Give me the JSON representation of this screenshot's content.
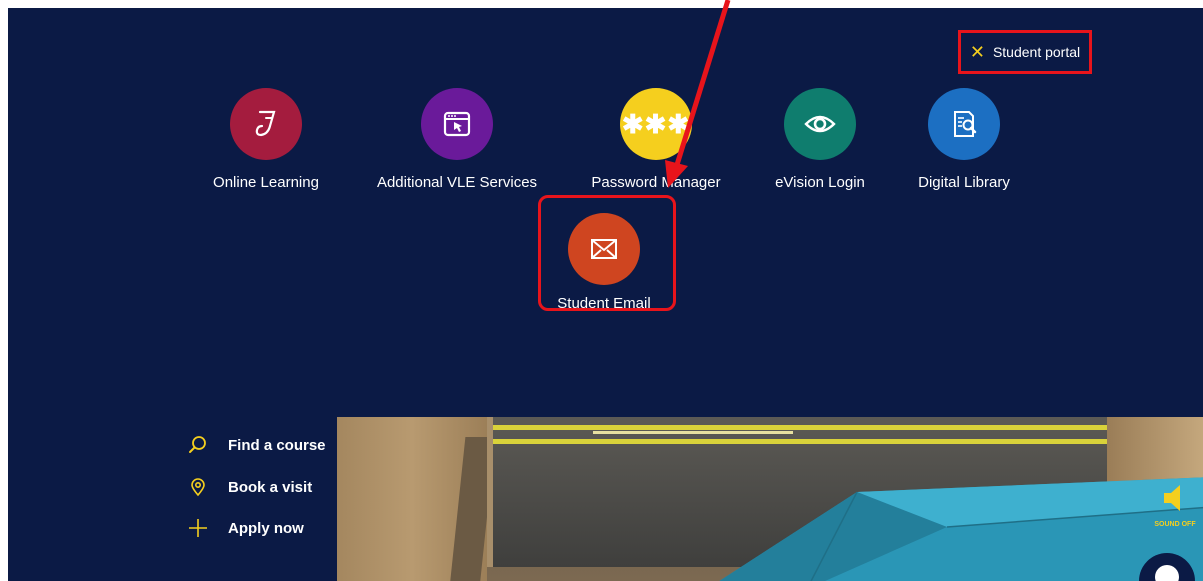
{
  "portal": {
    "close_label": "Student portal"
  },
  "tiles": [
    {
      "label": "Online Learning",
      "color": "#a41c3e",
      "icon": "pen-document-icon"
    },
    {
      "label": "Additional VLE Services",
      "color": "#6a1a9a",
      "icon": "browser-cursor-icon"
    },
    {
      "label": "Password Manager",
      "color": "#f5cf1e",
      "icon": "asterisks-icon"
    },
    {
      "label": "eVision Login",
      "color": "#0f7d6e",
      "icon": "eye-icon"
    },
    {
      "label": "Digital Library",
      "color": "#1c6fc2",
      "icon": "document-search-icon"
    },
    {
      "label": "Student Email",
      "color": "#cf4520",
      "icon": "envelope-icon"
    }
  ],
  "quick_links": [
    {
      "label": "Find a course",
      "icon": "search-icon"
    },
    {
      "label": "Book a visit",
      "icon": "location-pin-icon"
    },
    {
      "label": "Apply now",
      "icon": "plus-icon"
    }
  ],
  "sound": {
    "label": "SOUND OFF"
  },
  "colors": {
    "background": "#0b1a45",
    "accent": "#f5cf1e",
    "annotation": "#e8141b"
  }
}
